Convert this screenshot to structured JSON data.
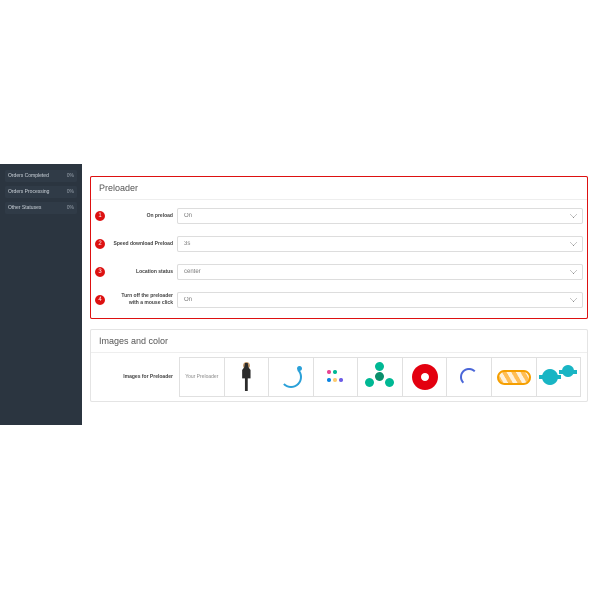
{
  "sidebar": {
    "stats": [
      {
        "label": "Orders Completed",
        "value": "0%"
      },
      {
        "label": "Orders Processing",
        "value": "0%"
      },
      {
        "label": "Other Statuses",
        "value": "0%"
      }
    ]
  },
  "preloader": {
    "title": "Preloader",
    "rows": [
      {
        "n": "1",
        "label": "On preload",
        "value": "On"
      },
      {
        "n": "2",
        "label": "Speed download Preload",
        "value": "3s"
      },
      {
        "n": "3",
        "label": "Location status",
        "value": "center"
      },
      {
        "n": "4",
        "label": "Turn off the preloader with a mouse click",
        "value": "On"
      }
    ]
  },
  "images": {
    "title": "Images and color",
    "label": "Images for Preloader",
    "first_cell": "Your Preloader"
  }
}
